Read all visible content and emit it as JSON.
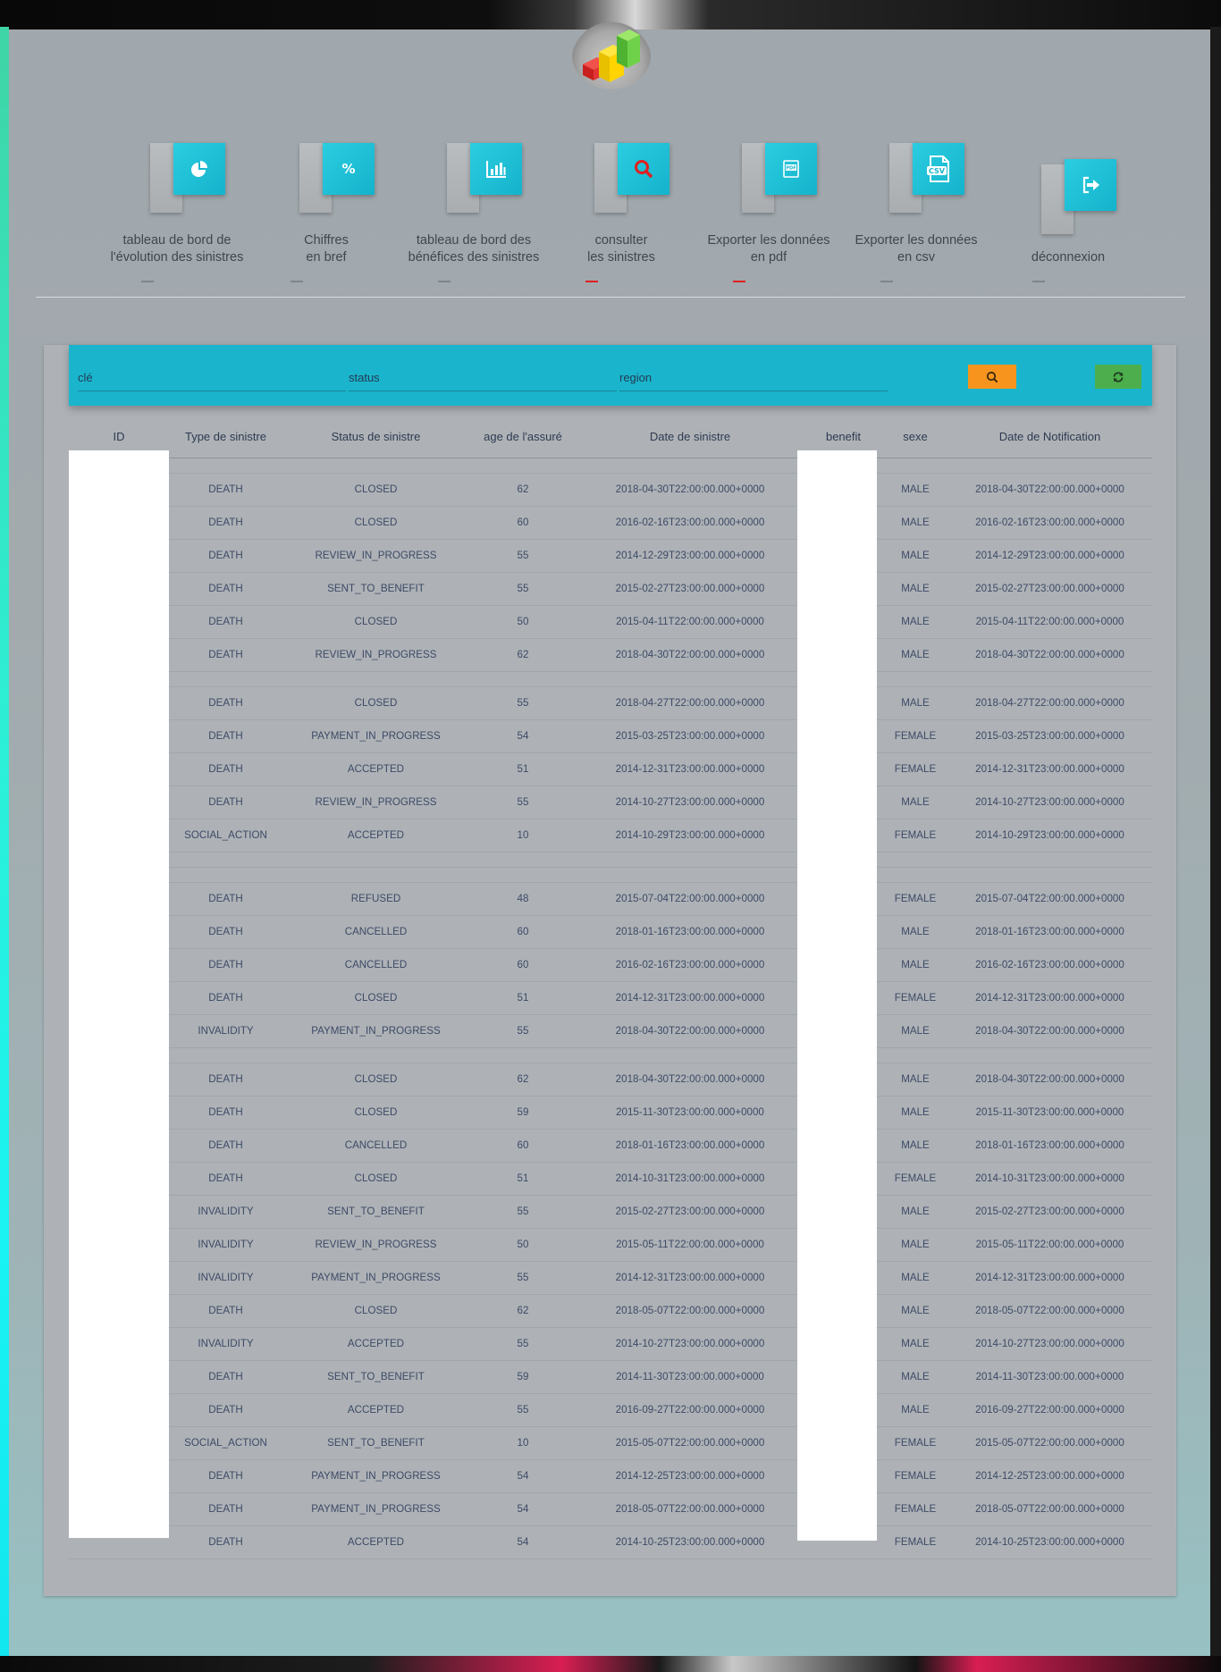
{
  "nav": [
    {
      "label": "tableau de bord de\nl'évolution des sinistres",
      "icon": "pie-chart-icon",
      "active": false
    },
    {
      "label": "Chiffres\nen bref",
      "icon": "percent-icon",
      "active": false
    },
    {
      "label": "tableau de bord des\nbénéfices des sinistres",
      "icon": "bar-chart-icon",
      "active": false
    },
    {
      "label": "consulter\nles sinistres",
      "icon": "search-icon",
      "active": true
    },
    {
      "label": "Exporter les données\nen pdf",
      "icon": "pdf-file-icon",
      "active": true
    },
    {
      "label": "Exporter les données\nen csv",
      "icon": "csv-file-icon",
      "active": false
    },
    {
      "label": "déconnexion",
      "icon": "logout-icon",
      "active": false
    }
  ],
  "filters": {
    "key_placeholder": "clé",
    "status_placeholder": "status",
    "region_placeholder": "region",
    "search_icon": "search-icon",
    "refresh_icon": "refresh-icon"
  },
  "colors": {
    "accent": "#1ab5cc",
    "search_button": "#f7941d",
    "refresh_button": "#4cae4c",
    "active_indicator": "#e02020"
  },
  "table": {
    "columns": [
      "ID",
      "Type de sinistre",
      "Status de sinistre",
      "age de l'assuré",
      "Date de sinistre",
      "benefit",
      "sexe",
      "Date de Notification"
    ],
    "rows": [
      {
        "blank": true
      },
      {
        "type": "DEATH",
        "status": "CLOSED",
        "age": "62",
        "date": "2018-04-30T22:00:00.000+0000",
        "sexe": "MALE",
        "notif": "2018-04-30T22:00:00.000+0000"
      },
      {
        "type": "DEATH",
        "status": "CLOSED",
        "age": "60",
        "date": "2016-02-16T23:00:00.000+0000",
        "sexe": "MALE",
        "notif": "2016-02-16T23:00:00.000+0000"
      },
      {
        "type": "DEATH",
        "status": "REVIEW_IN_PROGRESS",
        "age": "55",
        "date": "2014-12-29T23:00:00.000+0000",
        "sexe": "MALE",
        "notif": "2014-12-29T23:00:00.000+0000"
      },
      {
        "type": "DEATH",
        "status": "SENT_TO_BENEFIT",
        "age": "55",
        "date": "2015-02-27T23:00:00.000+0000",
        "sexe": "MALE",
        "notif": "2015-02-27T23:00:00.000+0000"
      },
      {
        "type": "DEATH",
        "status": "CLOSED",
        "age": "50",
        "date": "2015-04-11T22:00:00.000+0000",
        "sexe": "MALE",
        "notif": "2015-04-11T22:00:00.000+0000"
      },
      {
        "type": "DEATH",
        "status": "REVIEW_IN_PROGRESS",
        "age": "62",
        "date": "2018-04-30T22:00:00.000+0000",
        "sexe": "MALE",
        "notif": "2018-04-30T22:00:00.000+0000"
      },
      {
        "blank": true
      },
      {
        "type": "DEATH",
        "status": "CLOSED",
        "age": "55",
        "date": "2018-04-27T22:00:00.000+0000",
        "sexe": "MALE",
        "notif": "2018-04-27T22:00:00.000+0000"
      },
      {
        "type": "DEATH",
        "status": "PAYMENT_IN_PROGRESS",
        "age": "54",
        "date": "2015-03-25T23:00:00.000+0000",
        "sexe": "FEMALE",
        "notif": "2015-03-25T23:00:00.000+0000"
      },
      {
        "type": "DEATH",
        "status": "ACCEPTED",
        "age": "51",
        "date": "2014-12-31T23:00:00.000+0000",
        "sexe": "FEMALE",
        "notif": "2014-12-31T23:00:00.000+0000"
      },
      {
        "type": "DEATH",
        "status": "REVIEW_IN_PROGRESS",
        "age": "55",
        "date": "2014-10-27T23:00:00.000+0000",
        "sexe": "MALE",
        "notif": "2014-10-27T23:00:00.000+0000"
      },
      {
        "type": "SOCIAL_ACTION",
        "status": "ACCEPTED",
        "age": "10",
        "date": "2014-10-29T23:00:00.000+0000",
        "sexe": "FEMALE",
        "notif": "2014-10-29T23:00:00.000+0000"
      },
      {
        "blank": true
      },
      {
        "blank": true
      },
      {
        "type": "DEATH",
        "status": "REFUSED",
        "age": "48",
        "date": "2015-07-04T22:00:00.000+0000",
        "sexe": "FEMALE",
        "notif": "2015-07-04T22:00:00.000+0000"
      },
      {
        "type": "DEATH",
        "status": "CANCELLED",
        "age": "60",
        "date": "2018-01-16T23:00:00.000+0000",
        "sexe": "MALE",
        "notif": "2018-01-16T23:00:00.000+0000"
      },
      {
        "type": "DEATH",
        "status": "CANCELLED",
        "age": "60",
        "date": "2016-02-16T23:00:00.000+0000",
        "sexe": "MALE",
        "notif": "2016-02-16T23:00:00.000+0000"
      },
      {
        "type": "DEATH",
        "status": "CLOSED",
        "age": "51",
        "date": "2014-12-31T23:00:00.000+0000",
        "sexe": "FEMALE",
        "notif": "2014-12-31T23:00:00.000+0000"
      },
      {
        "type": "INVALIDITY",
        "status": "PAYMENT_IN_PROGRESS",
        "age": "55",
        "date": "2018-04-30T22:00:00.000+0000",
        "sexe": "MALE",
        "notif": "2018-04-30T22:00:00.000+0000"
      },
      {
        "blank": true
      },
      {
        "type": "DEATH",
        "status": "CLOSED",
        "age": "62",
        "date": "2018-04-30T22:00:00.000+0000",
        "sexe": "MALE",
        "notif": "2018-04-30T22:00:00.000+0000"
      },
      {
        "type": "DEATH",
        "status": "CLOSED",
        "age": "59",
        "date": "2015-11-30T23:00:00.000+0000",
        "sexe": "MALE",
        "notif": "2015-11-30T23:00:00.000+0000"
      },
      {
        "type": "DEATH",
        "status": "CANCELLED",
        "age": "60",
        "date": "2018-01-16T23:00:00.000+0000",
        "sexe": "MALE",
        "notif": "2018-01-16T23:00:00.000+0000"
      },
      {
        "type": "DEATH",
        "status": "CLOSED",
        "age": "51",
        "date": "2014-10-31T23:00:00.000+0000",
        "sexe": "FEMALE",
        "notif": "2014-10-31T23:00:00.000+0000"
      },
      {
        "type": "INVALIDITY",
        "status": "SENT_TO_BENEFIT",
        "age": "55",
        "date": "2015-02-27T23:00:00.000+0000",
        "sexe": "MALE",
        "notif": "2015-02-27T23:00:00.000+0000"
      },
      {
        "type": "INVALIDITY",
        "status": "REVIEW_IN_PROGRESS",
        "age": "50",
        "date": "2015-05-11T22:00:00.000+0000",
        "sexe": "MALE",
        "notif": "2015-05-11T22:00:00.000+0000"
      },
      {
        "type": "INVALIDITY",
        "status": "PAYMENT_IN_PROGRESS",
        "age": "55",
        "date": "2014-12-31T23:00:00.000+0000",
        "sexe": "MALE",
        "notif": "2014-12-31T23:00:00.000+0000"
      },
      {
        "type": "DEATH",
        "status": "CLOSED",
        "age": "62",
        "date": "2018-05-07T22:00:00.000+0000",
        "sexe": "MALE",
        "notif": "2018-05-07T22:00:00.000+0000"
      },
      {
        "type": "INVALIDITY",
        "status": "ACCEPTED",
        "age": "55",
        "date": "2014-10-27T23:00:00.000+0000",
        "sexe": "MALE",
        "notif": "2014-10-27T23:00:00.000+0000"
      },
      {
        "type": "DEATH",
        "status": "SENT_TO_BENEFIT",
        "age": "59",
        "date": "2014-11-30T23:00:00.000+0000",
        "sexe": "MALE",
        "notif": "2014-11-30T23:00:00.000+0000"
      },
      {
        "type": "DEATH",
        "status": "ACCEPTED",
        "age": "55",
        "date": "2016-09-27T22:00:00.000+0000",
        "sexe": "MALE",
        "notif": "2016-09-27T22:00:00.000+0000"
      },
      {
        "type": "SOCIAL_ACTION",
        "status": "SENT_TO_BENEFIT",
        "age": "10",
        "date": "2015-05-07T22:00:00.000+0000",
        "sexe": "FEMALE",
        "notif": "2015-05-07T22:00:00.000+0000"
      },
      {
        "type": "DEATH",
        "status": "PAYMENT_IN_PROGRESS",
        "age": "54",
        "date": "2014-12-25T23:00:00.000+0000",
        "sexe": "FEMALE",
        "notif": "2014-12-25T23:00:00.000+0000"
      },
      {
        "type": "DEATH",
        "status": "PAYMENT_IN_PROGRESS",
        "age": "54",
        "date": "2018-05-07T22:00:00.000+0000",
        "sexe": "FEMALE",
        "notif": "2018-05-07T22:00:00.000+0000"
      },
      {
        "type": "DEATH",
        "status": "ACCEPTED",
        "age": "54",
        "date": "2014-10-25T23:00:00.000+0000",
        "sexe": "FEMALE",
        "notif": "2014-10-25T23:00:00.000+0000"
      }
    ]
  }
}
